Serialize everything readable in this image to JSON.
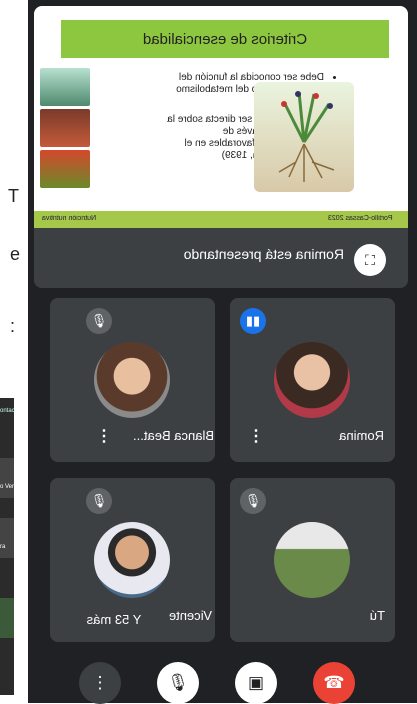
{
  "background": {
    "marks": [
      "T",
      "e",
      ":"
    ],
    "strip_label": "ontac",
    "strip_items": [
      "o Ver",
      "ra"
    ]
  },
  "slide": {
    "title": "Criterios de esencialidad",
    "bullets": [
      "Debe ser conocida la función del elemento dentro del metabolismo vegetal.",
      "Su acción debe ser directa sobre la planta y no a través de modificaciones favorables en el sustrato. (Arnon, 1939)"
    ],
    "footer_left": "Nutrición nutritiva",
    "footer_right": "Portillo-Cassas 2023"
  },
  "presenting": {
    "text": "Romina está presentando"
  },
  "participants": [
    {
      "name": "Romina",
      "speaking": true
    },
    {
      "name": "Blanca Beat...",
      "speaking": false
    },
    {
      "name": "Tú",
      "speaking": false
    },
    {
      "name": "Vicente",
      "speaking": false
    }
  ],
  "more": {
    "label": "Y 53 más"
  },
  "colors": {
    "accent_blue": "#1a73e8",
    "end_red": "#ea4335",
    "tile_bg": "#3c4043",
    "slide_title": "#8dc63f"
  },
  "icons": {
    "mic_off": "mic-off-icon",
    "speaking": "audio-wave-icon",
    "more": "more-vert-icon",
    "camera_off": "camera-off-icon",
    "end_call": "phone-end-icon",
    "fullscreen": "fullscreen-icon"
  }
}
